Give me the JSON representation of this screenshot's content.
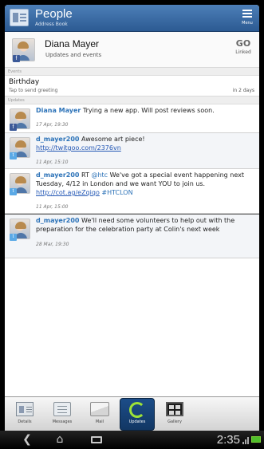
{
  "titlebar": {
    "title": "People",
    "subtitle": "Address Book",
    "menu_label": "Menu"
  },
  "contact": {
    "name": "Diana Mayer",
    "subtitle": "Updates and events",
    "link_label": "Linked",
    "link_icon": "GO"
  },
  "events": {
    "header": "Events",
    "items": [
      {
        "title": "Birthday",
        "subtitle": "Tap to send greeting",
        "when": "in 2 days"
      }
    ]
  },
  "updates": {
    "header": "Updates",
    "items": [
      {
        "author": "Diana Mayer",
        "before": " Trying a new app. Will post reviews soon.",
        "mention": "",
        "middle": "",
        "url": "",
        "after": "",
        "time": "17 Apr, 19:30",
        "source": "facebook"
      },
      {
        "author": "d_mayer200",
        "before": " Awesome art piece!",
        "mention": "",
        "middle": "",
        "url": "http://twitgoo.com/2376vn",
        "after": "",
        "time": "11 Apr, 15:10",
        "source": "twitter"
      },
      {
        "author": "d_mayer200",
        "before": " We've got a special event happening next Tuesday, 4/12 in London and we want YOU to join us. ",
        "mention": "",
        "middle": "",
        "url": "http://cot.ag/eZqiqo",
        "after": " #HTCLON",
        "time": "11 Apr, 15:00",
        "source": "twitter"
      },
      {
        "author": "d_mayer200",
        "before": " We'll need some volunteers to help out with the preparation for the celebration party at Colin's next week",
        "mention": "",
        "middle": "",
        "url": "",
        "after": "",
        "time": "28 Mar, 19:30",
        "source": "twitter"
      }
    ],
    "retweet": {
      "prefix": " RT ",
      "mention": "@htc"
    }
  },
  "tabs": [
    {
      "label": "Details",
      "icon": "details-icon",
      "active": false
    },
    {
      "label": "Messages",
      "icon": "messages-icon",
      "active": false
    },
    {
      "label": "Mail",
      "icon": "mail-icon",
      "active": false
    },
    {
      "label": "Updates",
      "icon": "updates-icon",
      "active": true
    },
    {
      "label": "Gallery",
      "icon": "gallery-icon",
      "active": false
    }
  ],
  "status": {
    "time": "2:35"
  },
  "colors": {
    "accent": "#2d73b8",
    "link": "#2458b5",
    "titlebar": "#2c5a92",
    "active_tab": "#1c4d88",
    "update_icon": "#9ee237",
    "battery": "#4fbf2b"
  }
}
